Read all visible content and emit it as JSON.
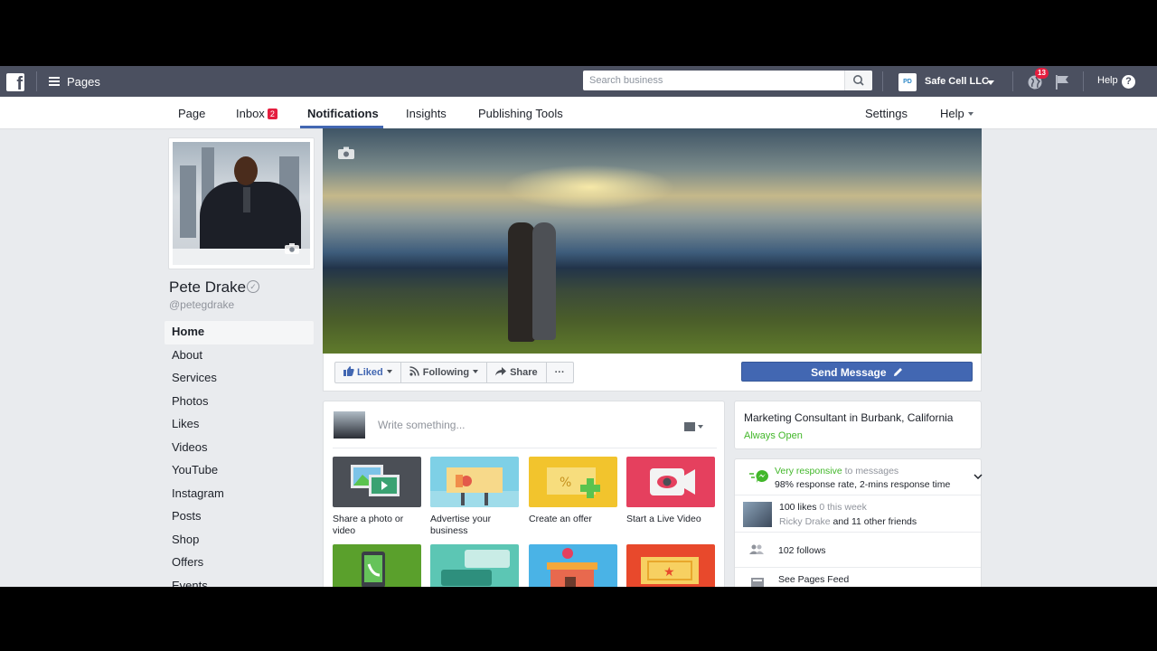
{
  "topbar": {
    "logo": "f",
    "pages_label": "Pages",
    "search_placeholder": "Search business",
    "account_initials": "PD",
    "account_name": "Safe Cell LLC",
    "notif_count": "13",
    "help_label": "Help",
    "help_symbol": "?"
  },
  "nav": {
    "page": "Page",
    "inbox": "Inbox",
    "inbox_count": "2",
    "notifications": "Notifications",
    "insights": "Insights",
    "publishing_tools": "Publishing Tools",
    "settings": "Settings",
    "help": "Help"
  },
  "profile": {
    "name": "Pete Drake",
    "verified_symbol": "✓",
    "handle": "@petegdrake"
  },
  "sidebar": {
    "items": [
      {
        "label": "Home"
      },
      {
        "label": "About"
      },
      {
        "label": "Services"
      },
      {
        "label": "Photos"
      },
      {
        "label": "Likes"
      },
      {
        "label": "Videos"
      },
      {
        "label": "YouTube"
      },
      {
        "label": "Instagram"
      },
      {
        "label": "Posts"
      },
      {
        "label": "Shop"
      },
      {
        "label": "Offers"
      },
      {
        "label": "Events"
      }
    ]
  },
  "actions": {
    "liked": "Liked",
    "following": "Following",
    "share": "Share",
    "more": "···",
    "send_message": "Send Message"
  },
  "composer": {
    "placeholder": "Write something...",
    "tiles": [
      {
        "label": "Share a photo or video"
      },
      {
        "label": "Advertise your business"
      },
      {
        "label": "Create an offer"
      },
      {
        "label": "Start a Live Video"
      }
    ]
  },
  "about": {
    "title": "Marketing Consultant in Burbank, California",
    "hours": "Always Open"
  },
  "stats": {
    "responsive": "Very responsive",
    "to_messages": "to messages",
    "response_detail": "98% response rate, 2-mins response time",
    "likes": "100 likes",
    "likes_week": "0 this week",
    "friend_name": "Ricky Drake",
    "friends_rest": "and 11 other friends",
    "follows": "102 follows",
    "pages_feed": "See Pages Feed"
  },
  "colors": {
    "topbar": "#4b5060",
    "accent": "#4267b2",
    "green": "#42b72a",
    "badge": "#e41e3f"
  }
}
